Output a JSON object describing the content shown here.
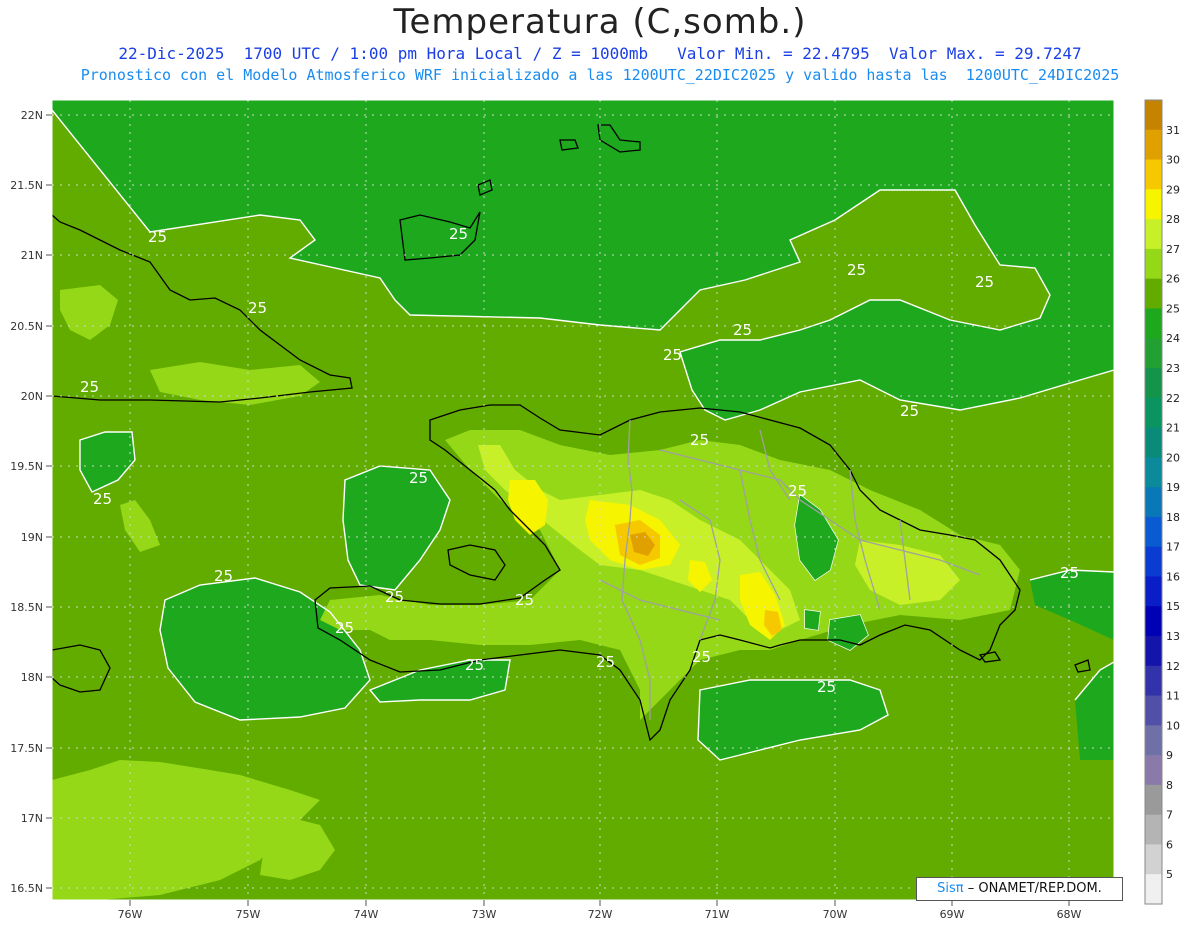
{
  "header": {
    "title": "Temperatura (C,somb.)",
    "subtitle_1": "22-Dic-2025  1700 UTC / 1:00 pm Hora Local / Z = 1000mb   Valor Min. = 22.4795  Valor Max. = 29.7247",
    "subtitle_2": "Pronostico con el Modelo Atmosferico WRF inicializado a las 1200UTC_22DIC2025 y valido hasta las  1200UTC_24DIC2025"
  },
  "axes": {
    "lat_labels": [
      "22N",
      "21.5N",
      "21N",
      "20.5N",
      "20N",
      "19.5N",
      "19N",
      "18.5N",
      "18N",
      "17.5N",
      "17N",
      "16.5N"
    ],
    "lon_labels": [
      "76W",
      "75W",
      "74W",
      "73W",
      "72W",
      "71W",
      "70W",
      "69W",
      "68W"
    ]
  },
  "colorbar": {
    "levels": [
      "31",
      "30",
      "29",
      "28",
      "27",
      "26",
      "25",
      "24",
      "23",
      "22",
      "21",
      "20",
      "19",
      "18",
      "17",
      "16",
      "15",
      "13",
      "12",
      "11",
      "10",
      "9",
      "8",
      "7",
      "6",
      "5"
    ],
    "colors": [
      "#c58400",
      "#e0a000",
      "#f5c800",
      "#f7f400",
      "#c8f028",
      "#94d818",
      "#62ac00",
      "#1ea81e",
      "#22a032",
      "#14944a",
      "#0a9460",
      "#0a8a78",
      "#0a8a9a",
      "#0a78b8",
      "#0a5ad2",
      "#0a3cd2",
      "#0a1ec8",
      "#0000b4",
      "#1414aa",
      "#3232aa",
      "#5050a8",
      "#7070a8",
      "#8a7aaa",
      "#9a9a9a",
      "#b4b4b4",
      "#d2d2d2",
      "#f0f0f0"
    ]
  },
  "map": {
    "contour_label": "25",
    "ocean_color": "#1ea81e",
    "land_color": "#62ac00"
  },
  "credit": {
    "brand": "Sisπ",
    "text": "– ONAMET/REP.DOM."
  }
}
